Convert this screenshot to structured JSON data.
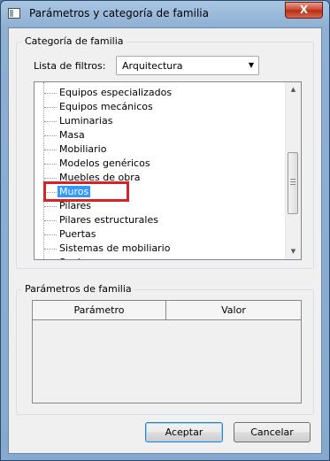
{
  "window": {
    "title": "Parámetros y categoría de familia",
    "close_glyph": "X"
  },
  "category_group": {
    "label": "Categoría de familia",
    "filter_label": "Lista de filtros:",
    "filter_value": "Arquitectura"
  },
  "tree": {
    "items": [
      {
        "label": "Equipos especializados"
      },
      {
        "label": "Equipos mecánicos"
      },
      {
        "label": "Luminarias"
      },
      {
        "label": "Masa"
      },
      {
        "label": "Mobiliario"
      },
      {
        "label": "Modelos genéricos"
      },
      {
        "label": "Muebles de obra"
      },
      {
        "label": "Muros"
      },
      {
        "label": "Pilares"
      },
      {
        "label": "Pilares estructurales"
      },
      {
        "label": "Puertas"
      },
      {
        "label": "Sistemas de mobiliario"
      },
      {
        "label": "Suelos"
      }
    ],
    "selected": "Muros"
  },
  "params_group": {
    "label": "Parámetros de familia",
    "columns": [
      "Parámetro",
      "Valor"
    ]
  },
  "buttons": {
    "ok": "Aceptar",
    "cancel": "Cancelar"
  },
  "colors": {
    "selection": "#3399ff",
    "annotation_box": "#d8222a",
    "close_button": "#c9412b"
  }
}
